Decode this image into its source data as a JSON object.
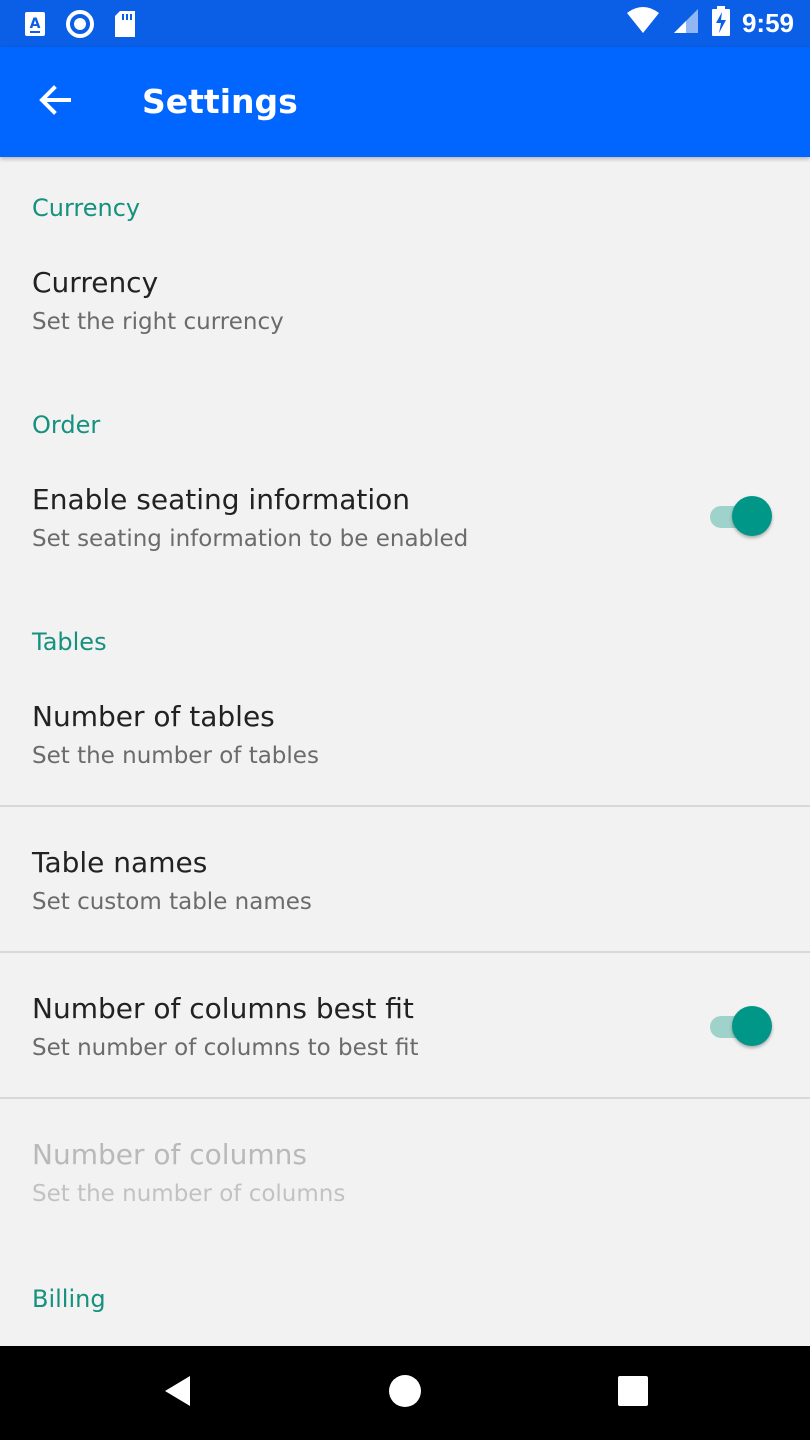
{
  "status_bar": {
    "time": "9:59",
    "left_icons": [
      "accessibility-a-icon",
      "sync-circle-icon",
      "sd-card-icon"
    ],
    "right_icons": [
      "wifi-icon",
      "cellular-signal-icon",
      "battery-charging-icon"
    ]
  },
  "app_bar": {
    "title": "Settings",
    "back_icon": "arrow-back-icon"
  },
  "settings": {
    "currency_header": "Currency",
    "currency": {
      "title": "Currency",
      "summary": "Set the right currency"
    },
    "order_header": "Order",
    "seating": {
      "title": "Enable seating information",
      "summary": "Set seating information to be enabled",
      "enabled": true
    },
    "tables_header": "Tables",
    "num_tables": {
      "title": "Number of tables",
      "summary": "Set the number of tables"
    },
    "table_names": {
      "title": "Table names",
      "summary": "Set custom table names"
    },
    "columns_best_fit": {
      "title": "Number of columns best fit",
      "summary": "Set number of columns to best fit",
      "enabled": true
    },
    "num_columns": {
      "title": "Number of columns",
      "summary": "Set the number of columns",
      "disabled": true
    },
    "billing_header": "Billing"
  },
  "colors": {
    "app_bar": "#0066ff",
    "status_bar": "#0a5fe6",
    "accent": "#009688",
    "section_header": "#17917f",
    "background": "#f2f2f2"
  },
  "nav_bar": {
    "icons": [
      "nav-back-icon",
      "nav-home-icon",
      "nav-recents-icon"
    ]
  }
}
